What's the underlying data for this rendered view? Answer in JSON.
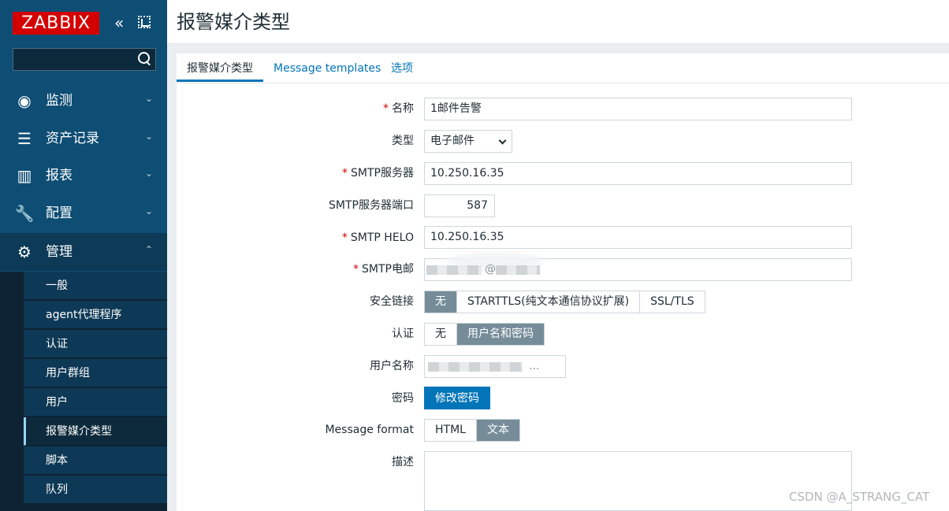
{
  "sidebar": {
    "logo": "ZABBIX",
    "collapse_icon": "«",
    "menu": [
      {
        "label": "监测",
        "icon": "eye-icon",
        "glyph": "◉"
      },
      {
        "label": "资产记录",
        "icon": "list-icon",
        "glyph": "☰"
      },
      {
        "label": "报表",
        "icon": "bar-chart-icon",
        "glyph": "▥"
      },
      {
        "label": "配置",
        "icon": "wrench-icon",
        "glyph": "🔧"
      },
      {
        "label": "管理",
        "icon": "gear-icon",
        "glyph": "⚙"
      }
    ],
    "admin_submenu": [
      "一般",
      "agent代理程序",
      "认证",
      "用户群组",
      "用户",
      "报警媒介类型",
      "脚本",
      "队列"
    ],
    "chevron_down": "⌄",
    "chevron_up": "⌃"
  },
  "header": {
    "title": "报警媒介类型"
  },
  "tabs": [
    "报警媒介类型",
    "Message templates",
    "选项"
  ],
  "form": {
    "name": {
      "label": "名称",
      "value": "1邮件告警"
    },
    "type": {
      "label": "类型",
      "value": "电子邮件"
    },
    "smtp_server": {
      "label": "SMTP服务器",
      "value": "10.250.16.35"
    },
    "smtp_port": {
      "label": "SMTP服务器端口",
      "value": "587"
    },
    "smtp_helo": {
      "label": "SMTP HELO",
      "value": "10.250.16.35"
    },
    "smtp_email": {
      "label": "SMTP电邮",
      "value": "@"
    },
    "security": {
      "label": "安全链接",
      "options": [
        "无",
        "STARTTLS(纯文本通信协议扩展)",
        "SSL/TLS"
      ],
      "selected": "无"
    },
    "auth": {
      "label": "认证",
      "options": [
        "无",
        "用户名和密码"
      ],
      "selected": "用户名和密码"
    },
    "username": {
      "label": "用户名称",
      "value": "..."
    },
    "password": {
      "label": "密码",
      "button": "修改密码"
    },
    "message_format": {
      "label": "Message format",
      "options": [
        "HTML",
        "文本"
      ],
      "selected": "文本"
    },
    "description": {
      "label": "描述",
      "value": ""
    },
    "required_mark": "*"
  },
  "watermark": "CSDN @A_STRANG_CAT",
  "colors": {
    "sidebar": "#0e4d74",
    "logo": "#d40000",
    "link": "#0275b8",
    "segment_on": "#768d99",
    "required": "#d40000"
  }
}
